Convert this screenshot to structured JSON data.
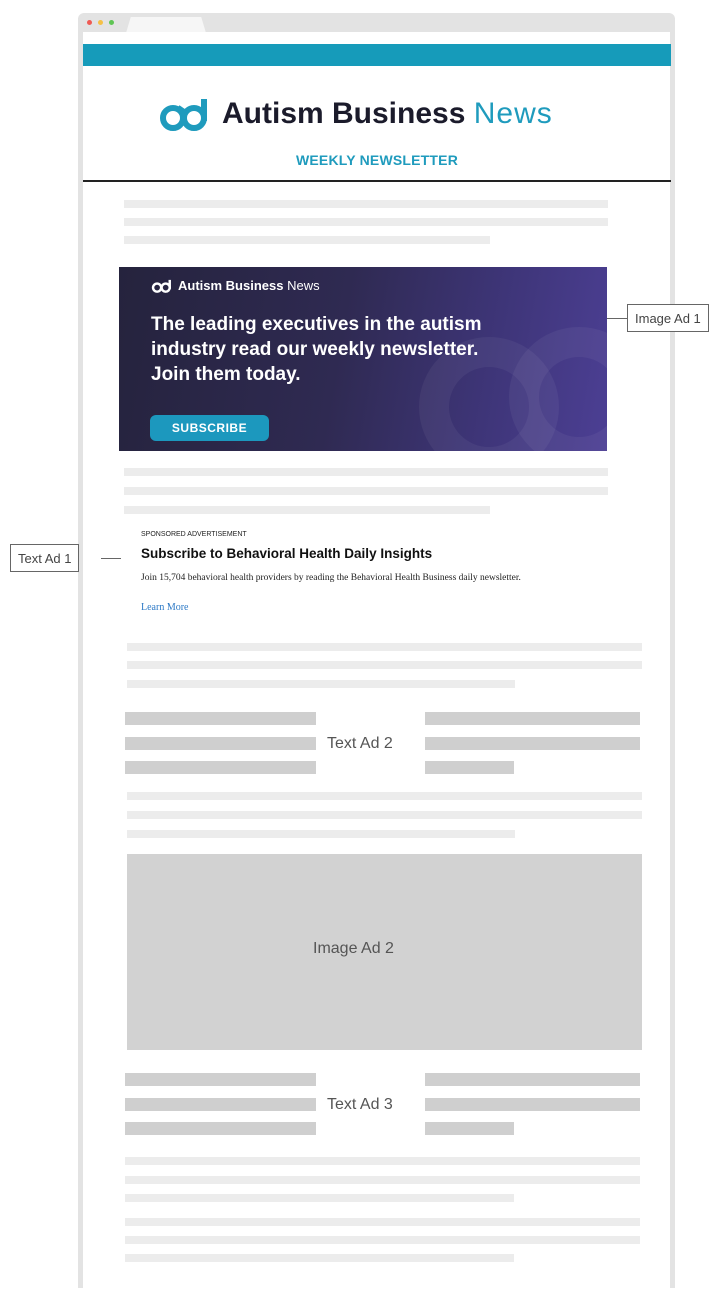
{
  "colors": {
    "brand_teal": "#1f9bbd",
    "header_bar": "#169bba",
    "banner_purple": "#3e3578",
    "placeholder_light": "#ececec",
    "placeholder_dark": "#cfcfcf"
  },
  "newsletter": {
    "brand_bold": "Autism Business",
    "brand_light": "News",
    "subtitle": "WEEKLY NEWSLETTER"
  },
  "image_ad_1": {
    "brand_bold": "Autism Business",
    "brand_light": "News",
    "headline": "The leading executives in the autism industry read our weekly newsletter. Join them today.",
    "button_label": "SUBSCRIBE"
  },
  "text_ad_1": {
    "label": "SPONSORED ADVERTISEMENT",
    "title": "Subscribe to Behavioral Health Daily Insights",
    "body": "Join 15,704 behavioral health providers by reading the Behavioral Health Business daily newsletter.",
    "link": "Learn More"
  },
  "callouts": {
    "image_ad_1": "Image Ad 1",
    "text_ad_1": "Text Ad 1",
    "text_ad_2": "Text Ad 2",
    "image_ad_2": "Image Ad 2",
    "text_ad_3": "Text Ad 3"
  }
}
